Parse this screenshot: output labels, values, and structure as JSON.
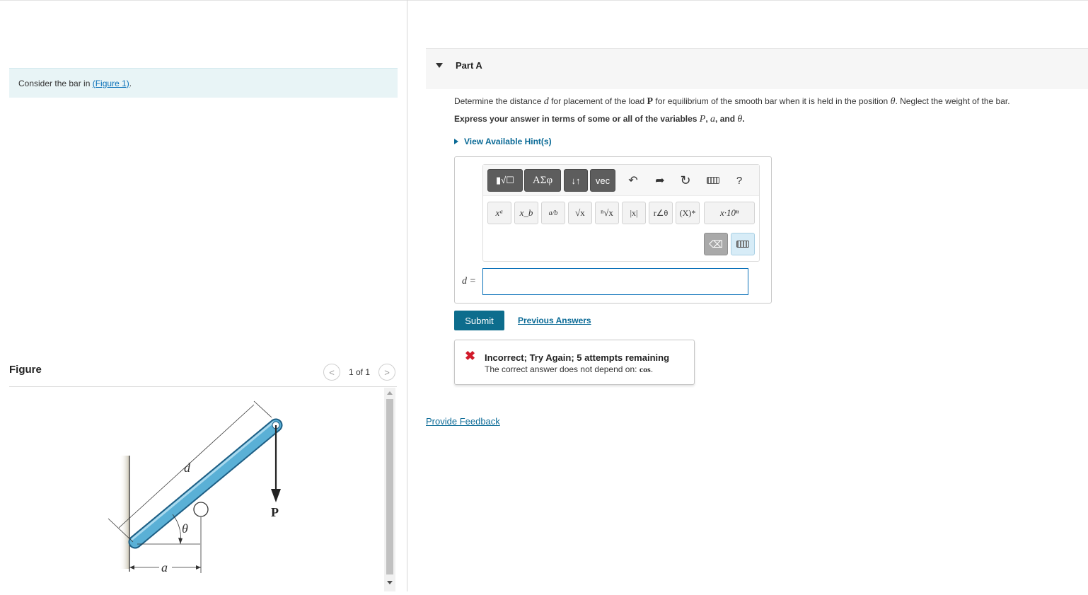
{
  "left": {
    "intro_prefix": "Consider the bar in ",
    "intro_link": "(Figure 1)",
    "intro_suffix": ".",
    "figure_title": "Figure",
    "pager_prev_icon": "chevron-left-icon",
    "pager_text": "1 of 1",
    "pager_next_icon": "chevron-right-icon",
    "figure_labels": {
      "d": "d",
      "theta": "θ",
      "P": "P",
      "a": "a"
    },
    "colors": {
      "bar": "#5ab0d6",
      "bar_edge": "#1e5f85",
      "intro_bg": "#e8f4f6"
    }
  },
  "part": {
    "title": "Part A",
    "q_pre": "Determine the distance ",
    "q_d": "d",
    "q_mid1": " for placement of the load ",
    "q_P": "P",
    "q_mid2": " for equilibrium of the smooth bar when it is held in the position ",
    "q_theta": "θ",
    "q_post": ". Neglect the weight of the bar.",
    "express_pre": "Express your answer in terms of some or all of the variables ",
    "express_P": "P",
    "express_sep1": ", ",
    "express_a": "a",
    "express_sep2": ", and ",
    "express_theta": "θ",
    "express_post": ".",
    "hint_label": "View Available Hint(s)"
  },
  "toolbar": {
    "templates_label": "▮√☐",
    "greek_label": "ΑΣφ",
    "arrows_label": "↓↑",
    "vec_label": "vec",
    "undo_icon": "undo-icon",
    "redo_icon": "redo-icon",
    "reset_icon": "reset-icon",
    "keyboard_icon": "keyboard-icon",
    "help_label": "?",
    "row2": [
      "xᵃ",
      "x_b",
      "a/b",
      "√x",
      "ⁿ√x",
      "|x|",
      "r∠θ",
      "(X)*",
      "x·10ⁿ"
    ],
    "backspace_icon": "backspace-icon",
    "keyboard_toggle_icon": "keyboard-toggle-icon"
  },
  "answer": {
    "label": "d =",
    "value": "",
    "placeholder": ""
  },
  "actions": {
    "submit": "Submit",
    "previous_answers": "Previous Answers"
  },
  "feedback": {
    "icon": "x-icon",
    "title": "Incorrect; Try Again; 5 attempts remaining",
    "message": "The correct answer does not depend on: ",
    "term": "cos",
    "message_end": "."
  },
  "provide_feedback": "Provide Feedback"
}
